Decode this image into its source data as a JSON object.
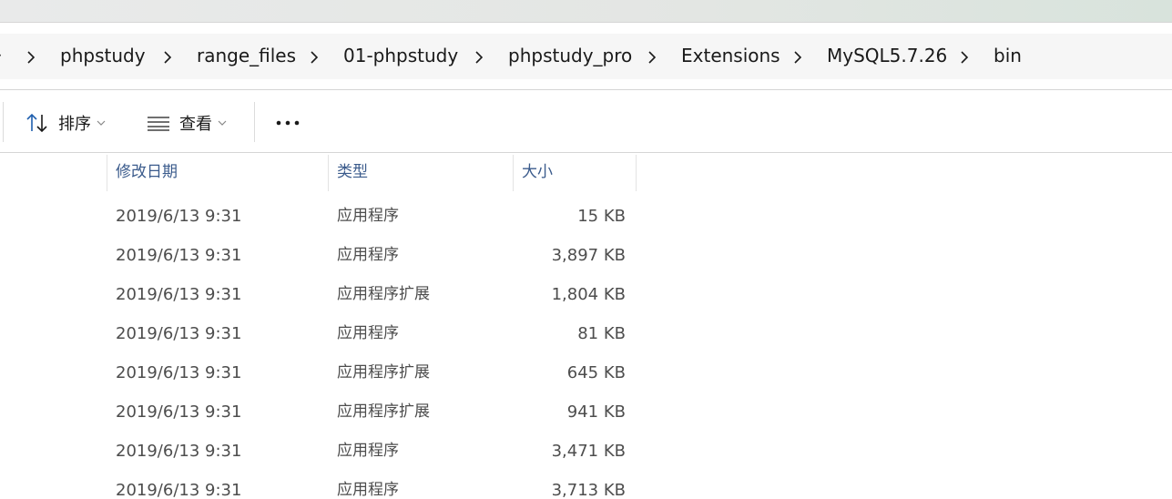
{
  "breadcrumb": {
    "edge_glyph": "›",
    "items": [
      "phpstudy",
      "range_files",
      "01-phpstudy",
      "phpstudy_pro",
      "Extensions",
      "MySQL5.7.26",
      "bin"
    ]
  },
  "toolbar": {
    "sort_label": "排序",
    "view_label": "查看",
    "more_label": "···"
  },
  "columns": {
    "date": "修改日期",
    "type": "类型",
    "size": "大小"
  },
  "rows": [
    {
      "date": "2019/6/13 9:31",
      "type": "应用程序",
      "size": "15 KB"
    },
    {
      "date": "2019/6/13 9:31",
      "type": "应用程序",
      "size": "3,897 KB"
    },
    {
      "date": "2019/6/13 9:31",
      "type": "应用程序扩展",
      "size": "1,804 KB"
    },
    {
      "date": "2019/6/13 9:31",
      "type": "应用程序",
      "size": "81 KB"
    },
    {
      "date": "2019/6/13 9:31",
      "type": "应用程序扩展",
      "size": "645 KB"
    },
    {
      "date": "2019/6/13 9:31",
      "type": "应用程序扩展",
      "size": "941 KB"
    },
    {
      "date": "2019/6/13 9:31",
      "type": "应用程序",
      "size": "3,471 KB"
    },
    {
      "date": "2019/6/13 9:31",
      "type": "应用程序",
      "size": "3,713 KB"
    }
  ]
}
